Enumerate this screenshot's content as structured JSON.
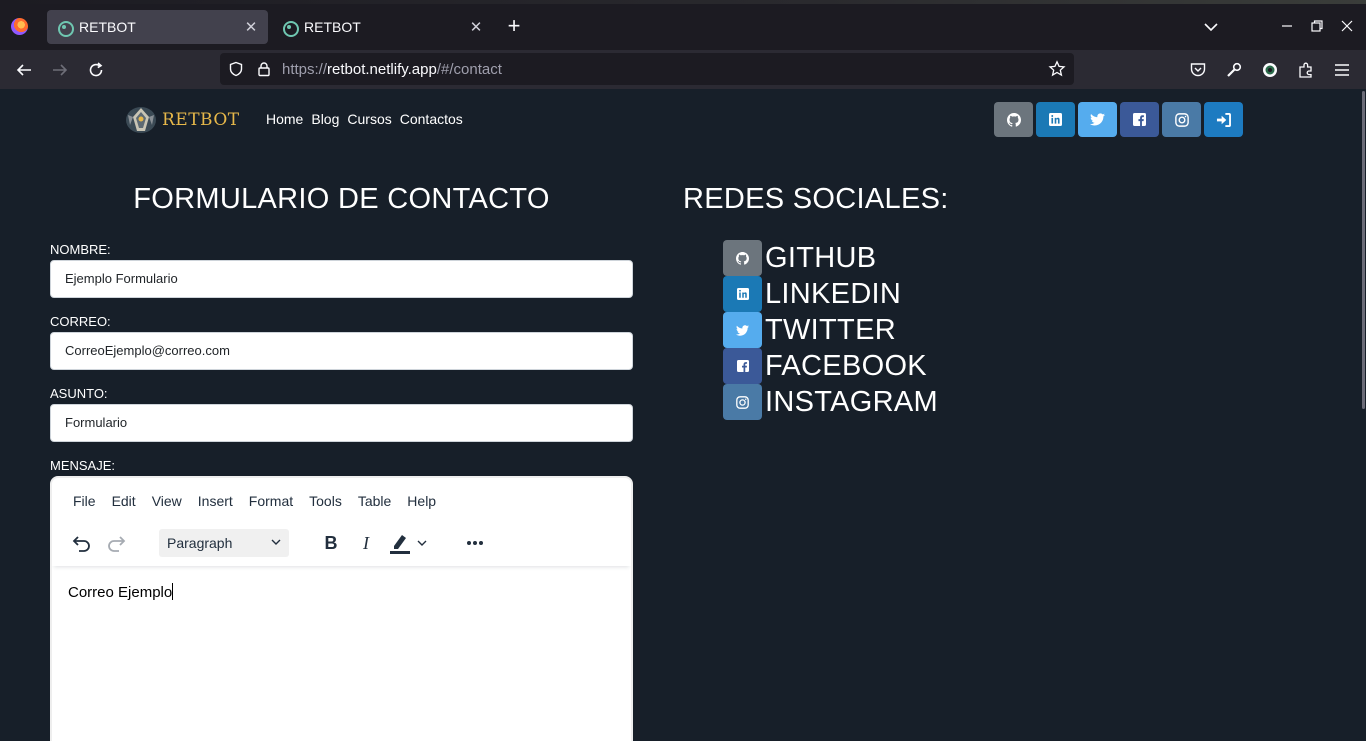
{
  "browser": {
    "tabs": [
      {
        "title": "RETBOT",
        "active": true
      },
      {
        "title": "RETBOT",
        "active": false
      }
    ],
    "url_scheme": "https://",
    "url_host": "retbot.netlify.app",
    "url_path": "/#/contact"
  },
  "site": {
    "logo_text": "RETBOT",
    "nav": [
      "Home",
      "Blog",
      "Cursos",
      "Contactos"
    ],
    "social_buttons": [
      {
        "name": "github",
        "color": "#6c757d"
      },
      {
        "name": "linkedin",
        "color": "#1b79b5"
      },
      {
        "name": "twitter",
        "color": "#55acee"
      },
      {
        "name": "facebook",
        "color": "#3b5998"
      },
      {
        "name": "instagram",
        "color": "#4a7aa6"
      },
      {
        "name": "login",
        "color": "#1d7bc1"
      }
    ]
  },
  "form": {
    "title": "FORMULARIO DE CONTACTO",
    "nombre_label": "NOMBRE:",
    "nombre_value": "Ejemplo Formulario",
    "correo_label": "CORREO:",
    "correo_value": "CorreoEjemplo@correo.com",
    "asunto_label": "ASUNTO:",
    "asunto_value": "Formulario",
    "mensaje_label": "MENSAJE:"
  },
  "editor": {
    "menu": [
      "File",
      "Edit",
      "View",
      "Insert",
      "Format",
      "Tools",
      "Table",
      "Help"
    ],
    "block_format": "Paragraph",
    "content": "Correo Ejemplo"
  },
  "redes": {
    "title": "REDES SOCIALES:",
    "items": [
      {
        "label": "GITHUB",
        "icon": "github-icon",
        "color": "#6c757d"
      },
      {
        "label": "LINKEDIN",
        "icon": "linkedin-icon",
        "color": "#1b79b5"
      },
      {
        "label": "TWITTER",
        "icon": "twitter-icon",
        "color": "#55acee"
      },
      {
        "label": "FACEBOOK",
        "icon": "facebook-icon",
        "color": "#3b5998"
      },
      {
        "label": "INSTAGRAM",
        "icon": "instagram-icon",
        "color": "#4a7aa6"
      }
    ]
  },
  "colors": {
    "page_bg": "#171f29",
    "logo_gold": "#e7b84a"
  }
}
